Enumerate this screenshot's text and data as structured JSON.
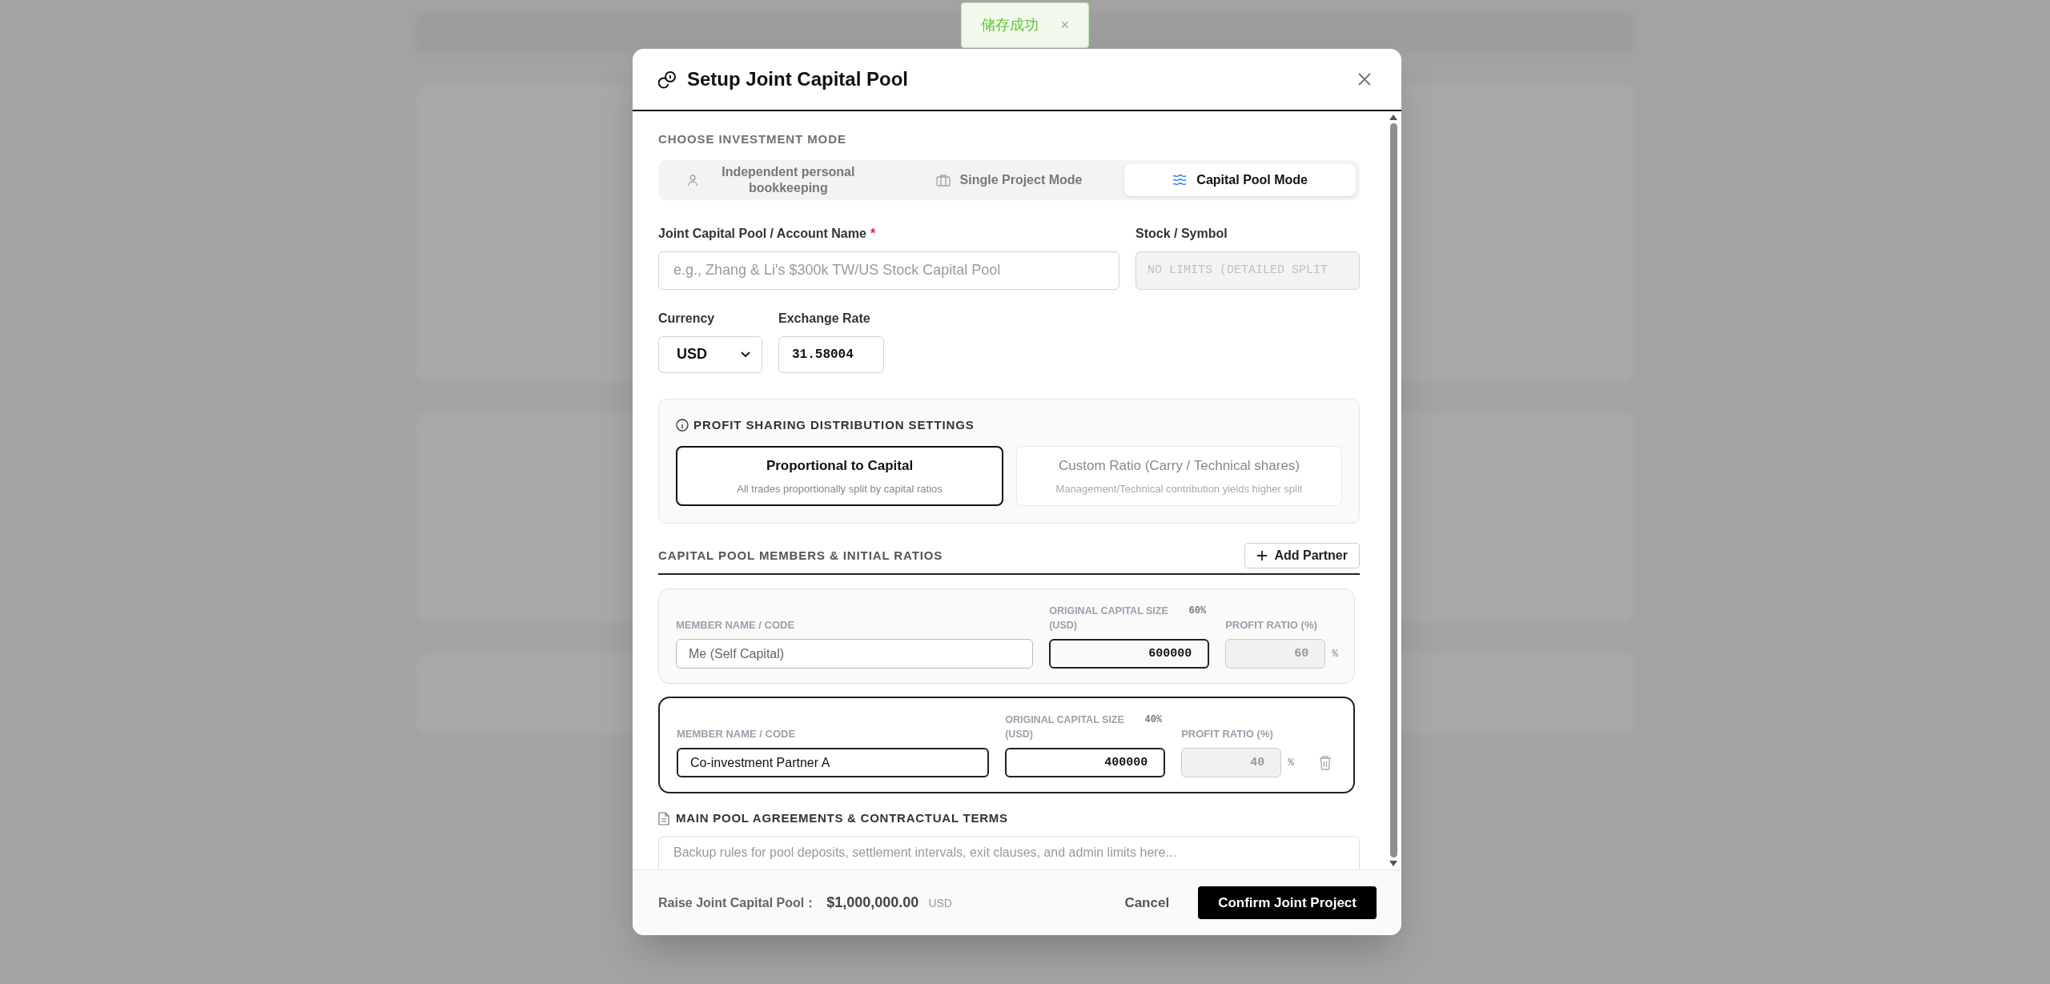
{
  "toast": {
    "message": "储存成功",
    "close": "×"
  },
  "dialog": {
    "title": "Setup Joint Capital Pool",
    "mode_section": {
      "label": "CHOOSE INVESTMENT MODE",
      "tabs": [
        {
          "label": "Independent personal bookkeeping",
          "kind": "person",
          "selected": false
        },
        {
          "label": "Single Project Mode",
          "kind": "briefcase",
          "selected": false
        },
        {
          "label": "Capital Pool Mode",
          "kind": "waves",
          "selected": true
        }
      ]
    },
    "name_field": {
      "label": "Joint Capital Pool / Account Name",
      "required_mark": "*",
      "placeholder": "e.g., Zhang & Li's $300k TW/US Stock Capital Pool"
    },
    "symbol_field": {
      "label": "Stock / Symbol",
      "placeholder": "NO LIMITS (DETAILED SPLIT",
      "disabled": true
    },
    "currency_field": {
      "label": "Currency",
      "value": "USD"
    },
    "rate_field": {
      "label": "Exchange Rate",
      "value": "31.58004"
    },
    "profit_section": {
      "label": "PROFIT SHARING DISTRIBUTION SETTINGS",
      "options": [
        {
          "title": "Proportional to Capital",
          "subtitle": "All trades proportionally split by capital ratios",
          "selected": true
        },
        {
          "title": "Custom Ratio (Carry / Technical shares)",
          "subtitle": "Management/Technical contribution yields higher split",
          "selected": false
        }
      ]
    },
    "members_section": {
      "label": "CAPITAL POOL MEMBERS & INITIAL RATIOS",
      "add_button": "Add Partner",
      "members": [
        {
          "name_label": "MEMBER NAME / CODE",
          "name": "Me (Self Capital)",
          "capital_label": "ORIGINAL CAPITAL SIZE (USD)",
          "share": "60%",
          "capital": "600000",
          "ratio_label": "PROFIT RATIO (%)",
          "ratio": "60",
          "unit": "%",
          "locked": true
        },
        {
          "name_label": "MEMBER NAME / CODE",
          "name": "Co-investment Partner A",
          "capital_label": "ORIGINAL CAPITAL SIZE (USD)",
          "share": "40%",
          "capital": "400000",
          "ratio_label": "PROFIT RATIO (%)",
          "ratio": "40",
          "unit": "%",
          "locked": false
        }
      ]
    },
    "terms_section": {
      "label": "MAIN POOL AGREEMENTS & CONTRACTUAL TERMS",
      "placeholder": "Backup rules for pool deposits, settlement intervals, exit clauses, and admin limits here..."
    },
    "footer": {
      "total_label": "Raise Joint Capital Pool：",
      "total": "$1,000,000.00",
      "currency": "USD",
      "cancel": "Cancel",
      "confirm": "Confirm Joint Project"
    }
  }
}
